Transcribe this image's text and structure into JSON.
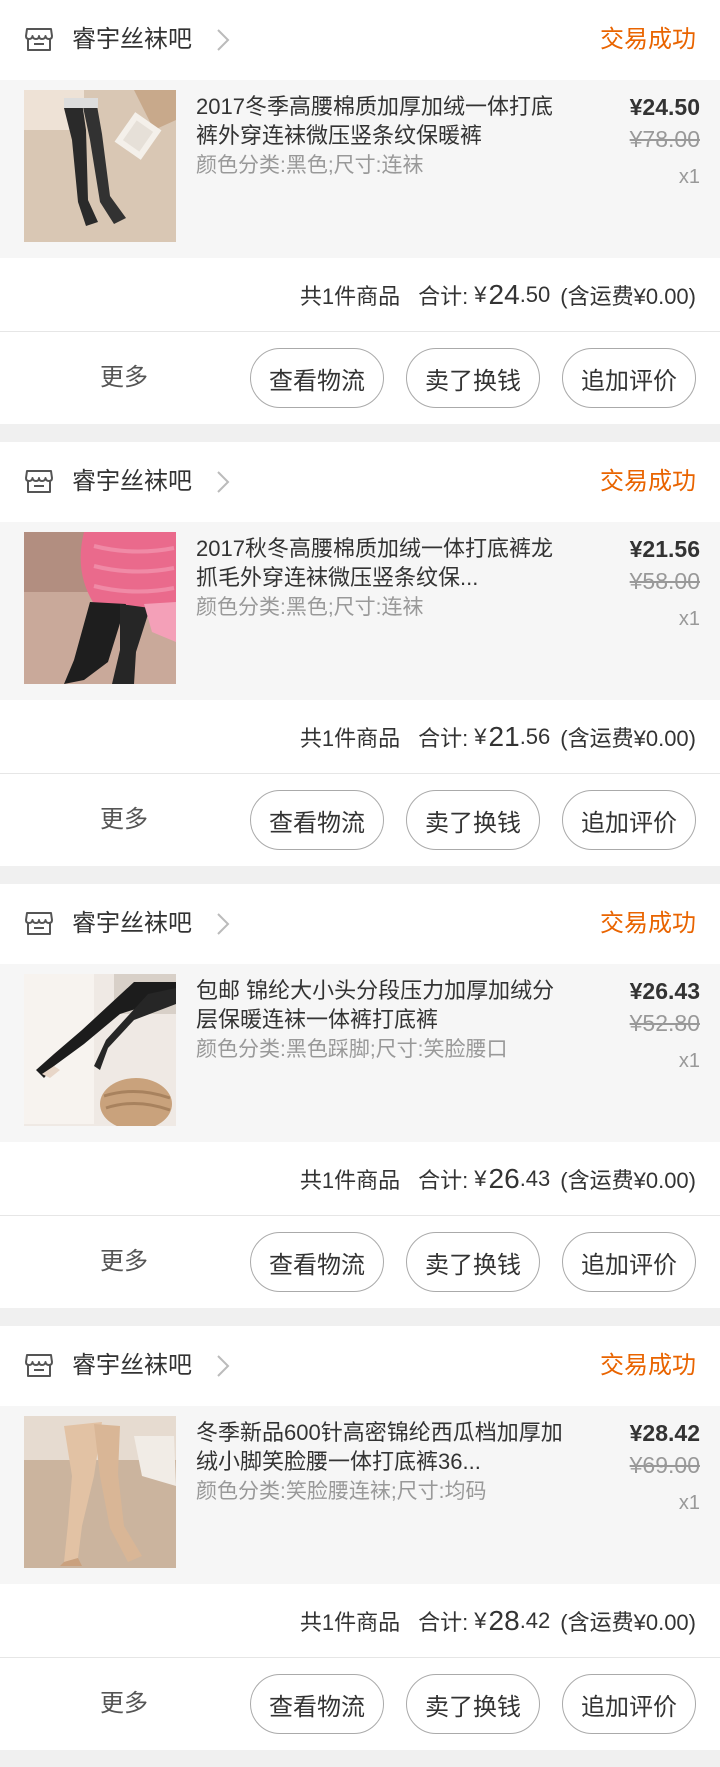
{
  "colors": {
    "status": "#e96400",
    "background": "#f2f2f2",
    "item_bg": "#f6f6f6"
  },
  "icons": {
    "shop": "shop-icon",
    "chevron": "chevron-right-icon"
  },
  "orders": [
    {
      "shop": "睿宇丝袜吧",
      "status": "交易成功",
      "thumb": "pantyhose-cream-background",
      "title": "2017冬季高腰棉质加厚加绒一体打底裤外穿连袜微压竖条纹保暖裤",
      "sku": "颜色分类:黑色;尺寸:连袜",
      "price": "¥24.50",
      "orig_price": "¥78.00",
      "qty": "x1",
      "total": {
        "count": "共1件商品",
        "label": "合计:",
        "yen": "¥",
        "int": "24",
        "dec": ".50",
        "shipping": "(含运费¥0.00)"
      },
      "buttons": {
        "more": "更多",
        "logistics": "查看物流",
        "resell": "卖了换钱",
        "review": "追加评价"
      }
    },
    {
      "shop": "睿宇丝袜吧",
      "status": "交易成功",
      "thumb": "tights-pink-sweater",
      "title": "2017秋冬高腰棉质加绒一体打底裤龙抓毛外穿连袜微压竖条纹保...",
      "sku": "颜色分类:黑色;尺寸:连袜",
      "price": "¥21.56",
      "orig_price": "¥58.00",
      "qty": "x1",
      "total": {
        "count": "共1件商品",
        "label": "合计:",
        "yen": "¥",
        "int": "21",
        "dec": ".56",
        "shipping": "(含运费¥0.00)"
      },
      "buttons": {
        "more": "更多",
        "logistics": "查看物流",
        "resell": "卖了换钱",
        "review": "追加评价"
      }
    },
    {
      "shop": "睿宇丝袜吧",
      "status": "交易成功",
      "thumb": "stirrup-tights-leg",
      "title": "包邮 锦纶大小头分段压力加厚加绒分层保暖连袜一体裤打底裤",
      "sku": "颜色分类:黑色踩脚;尺寸:笑脸腰口",
      "price": "¥26.43",
      "orig_price": "¥52.80",
      "qty": "x1",
      "total": {
        "count": "共1件商品",
        "label": "合计:",
        "yen": "¥",
        "int": "26",
        "dec": ".43",
        "shipping": "(含运费¥0.00)"
      },
      "buttons": {
        "more": "更多",
        "logistics": "查看物流",
        "resell": "卖了换钱",
        "review": "追加评价"
      }
    },
    {
      "shop": "睿宇丝袜吧",
      "status": "交易成功",
      "thumb": "nude-tights-legs",
      "title": "冬季新品600针高密锦纶西瓜档加厚加绒小脚笑脸腰一体打底裤36...",
      "sku": "颜色分类:笑脸腰连袜;尺寸:均码",
      "price": "¥28.42",
      "orig_price": "¥69.00",
      "qty": "x1",
      "total": {
        "count": "共1件商品",
        "label": "合计:",
        "yen": "¥",
        "int": "28",
        "dec": ".42",
        "shipping": "(含运费¥0.00)"
      },
      "buttons": {
        "more": "更多",
        "logistics": "查看物流",
        "resell": "卖了换钱",
        "review": "追加评价"
      }
    }
  ]
}
